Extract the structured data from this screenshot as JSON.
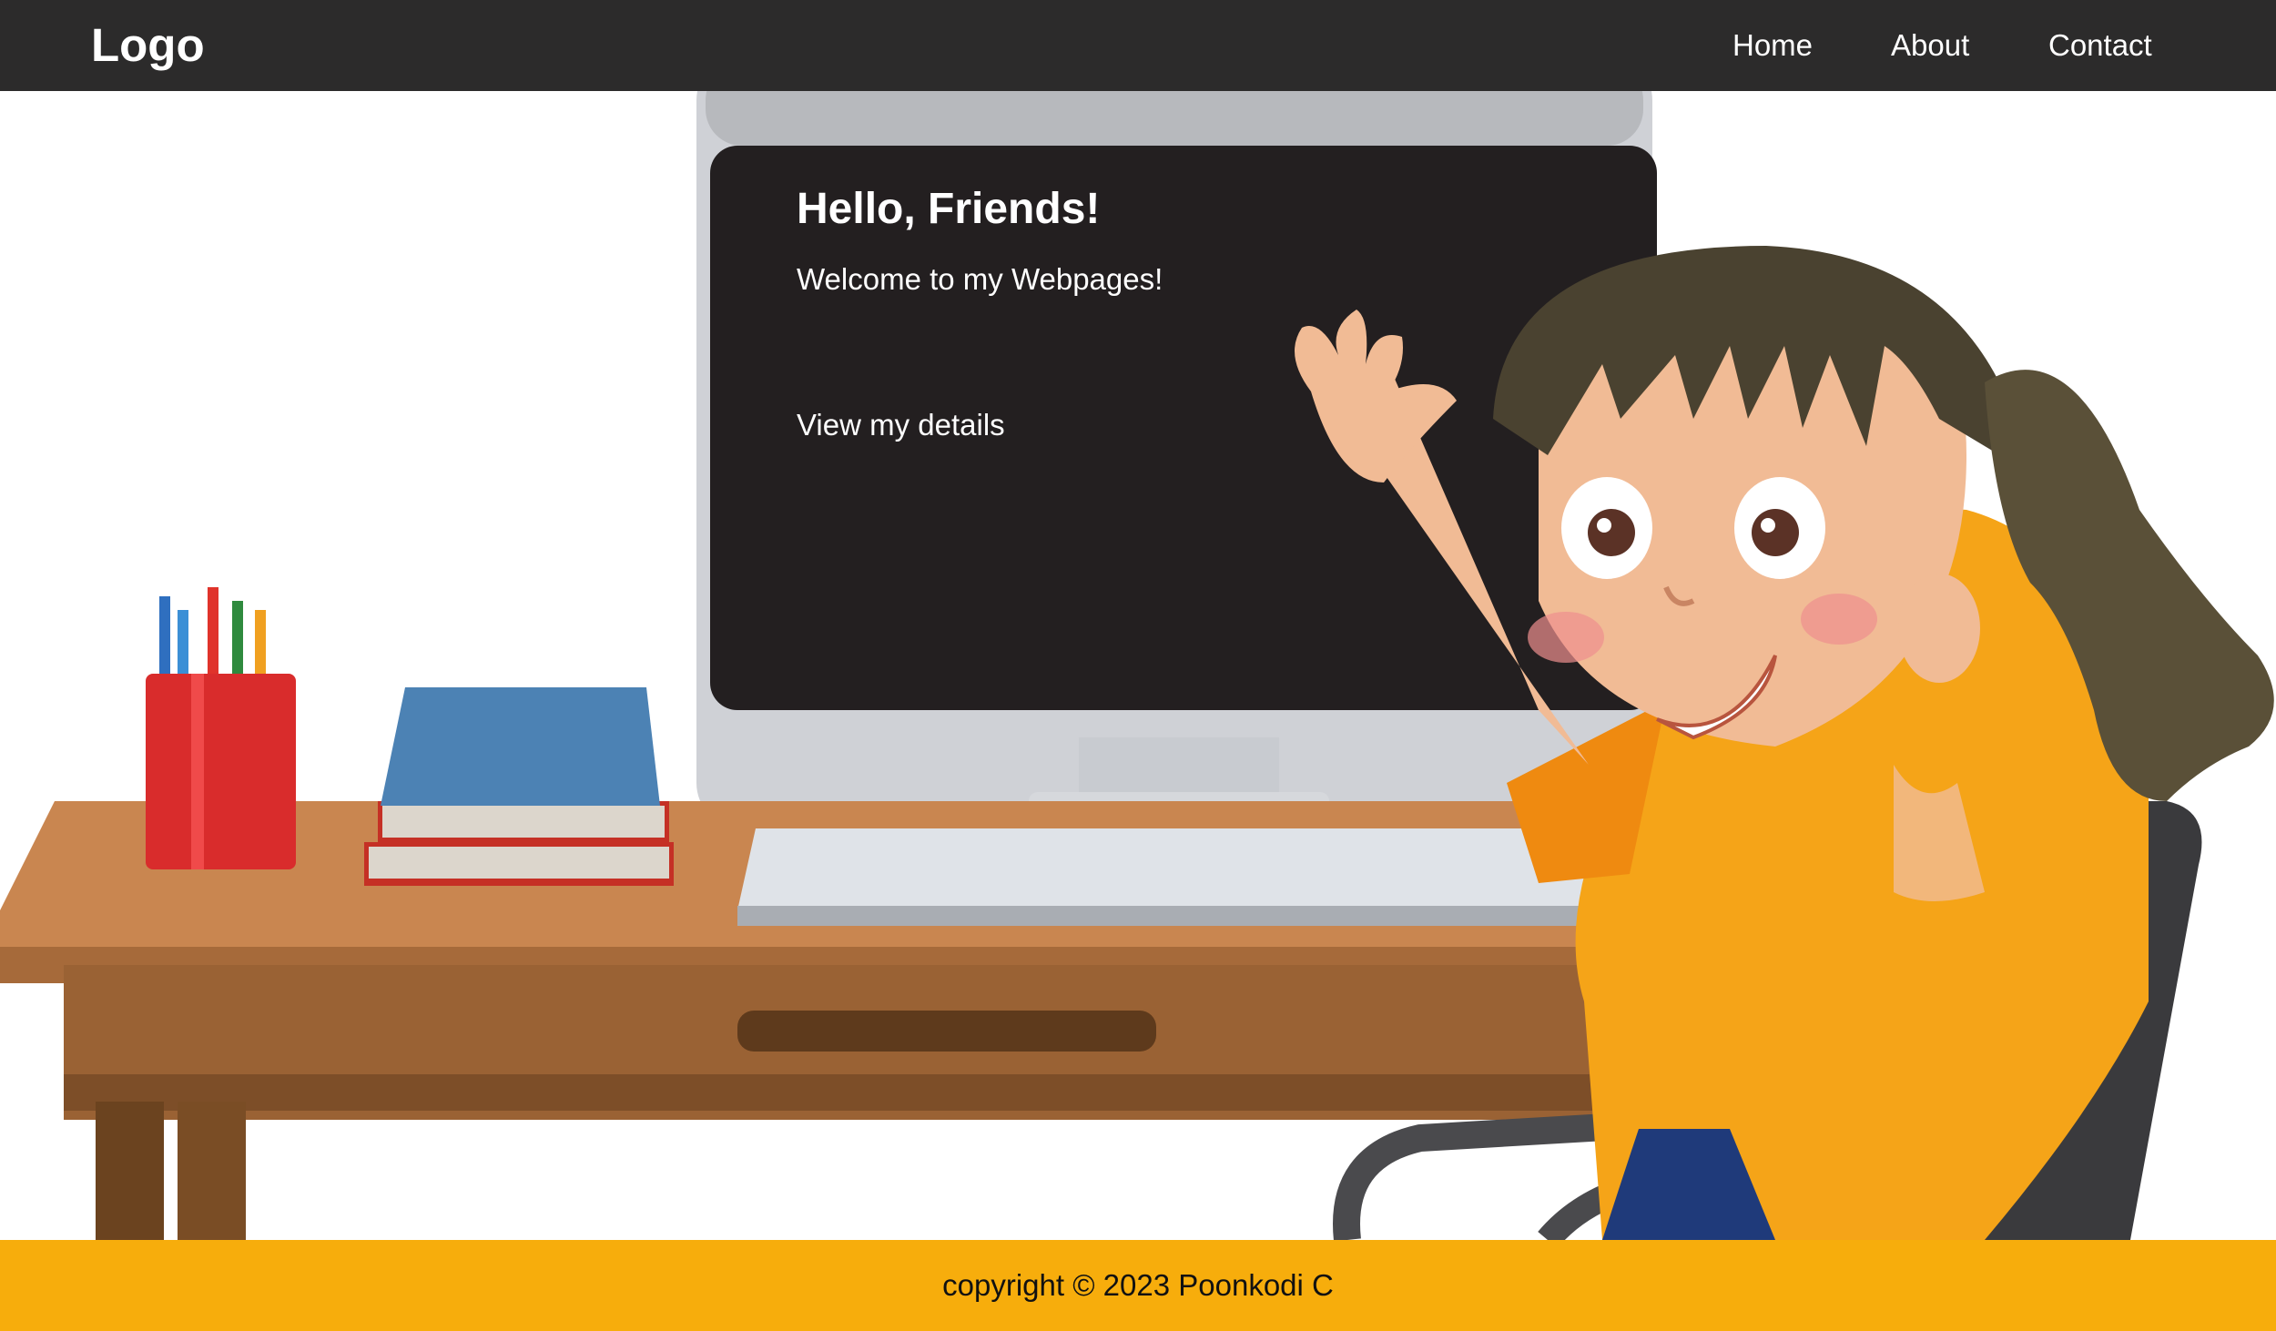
{
  "navbar": {
    "logo": "Logo",
    "links": [
      "Home",
      "About",
      "Contact"
    ]
  },
  "hero": {
    "title": "Hello, Friends!",
    "subtitle": "Welcome to my Webpages!",
    "cta": "View my details"
  },
  "footer": {
    "copyright": "copyright © 2023 Poonkodi C"
  },
  "colors": {
    "navbar": "#2c2b2b",
    "footer": "#f7ad0c",
    "monitor_screen": "#231f20",
    "desk": "#c98650",
    "shirt": "#f5a418",
    "hair": "#4a4230"
  }
}
